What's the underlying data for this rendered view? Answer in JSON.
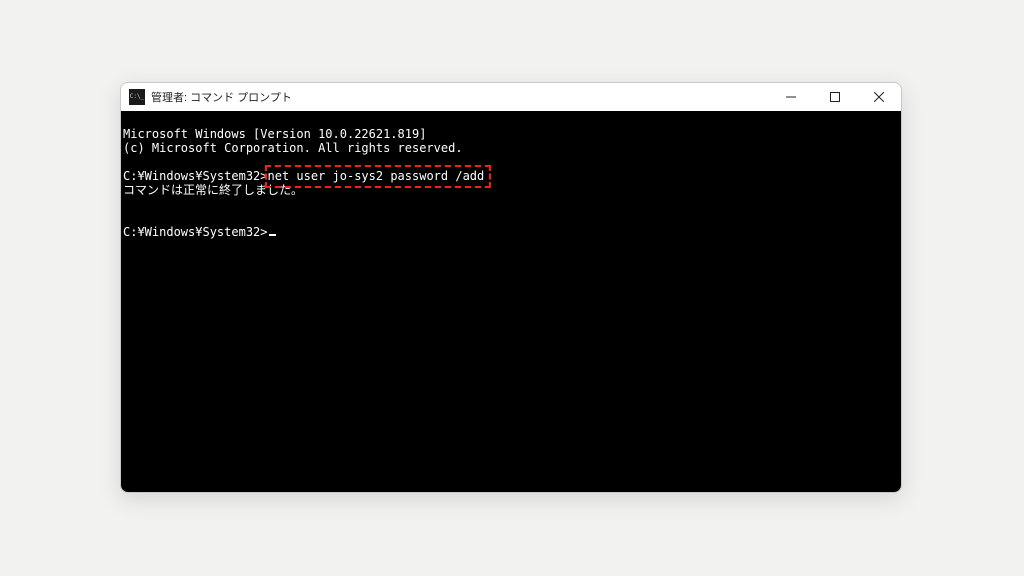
{
  "window": {
    "title": "管理者: コマンド プロンプト"
  },
  "terminal": {
    "line1": "Microsoft Windows [Version 10.0.22621.819]",
    "line2": "(c) Microsoft Corporation. All rights reserved.",
    "blank1": "",
    "line3_prompt": "C:¥Windows¥System32>",
    "line3_cmd": "net user jo-sys2 password /add",
    "line4": "コマンドは正常に終了しました。",
    "blank2": "",
    "blank3": "",
    "line5_prompt": "C:¥Windows¥System32>"
  },
  "highlight": {
    "target_text": "net user jo-sys2 password /add"
  }
}
